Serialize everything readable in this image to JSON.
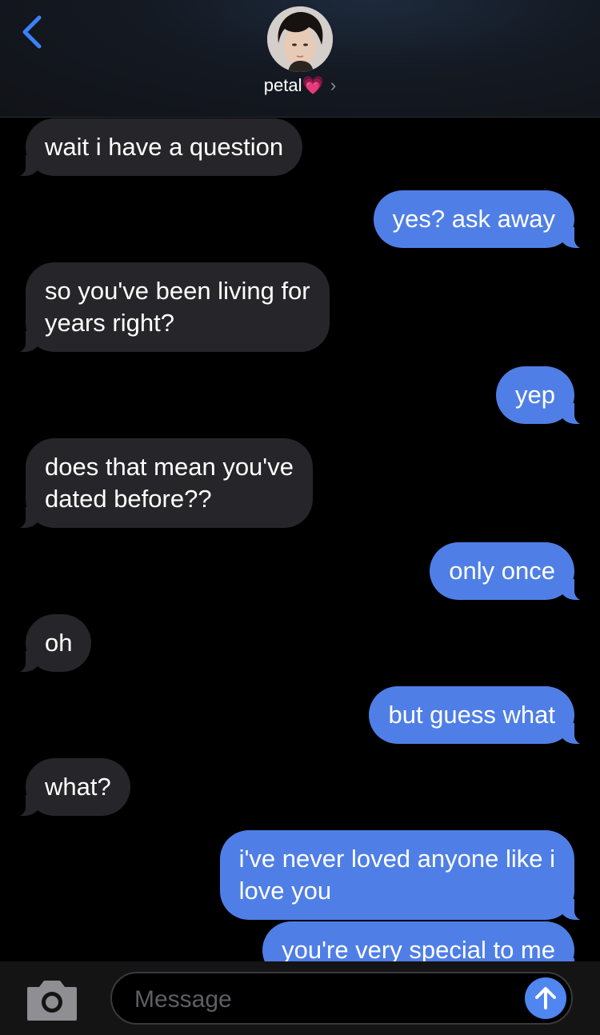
{
  "header": {
    "contact_name": "petal💗",
    "chevron": "›",
    "back_icon": "chevron-left-icon",
    "accent_color": "#3b82f6"
  },
  "messages": [
    {
      "from": "them",
      "text": "wait i have a question"
    },
    {
      "from": "me",
      "text": "yes? ask away"
    },
    {
      "from": "them",
      "line1": "so you've been living for",
      "line2": "years right?"
    },
    {
      "from": "me",
      "text": "yep"
    },
    {
      "from": "them",
      "line1": "does that mean you've",
      "line2": "dated before??"
    },
    {
      "from": "me",
      "text": "only once"
    },
    {
      "from": "them",
      "text": "oh"
    },
    {
      "from": "me",
      "text": "but guess what"
    },
    {
      "from": "them",
      "text": "what?"
    },
    {
      "from": "me",
      "line1": "i've never loved anyone like i",
      "line2": "love you"
    },
    {
      "from": "me",
      "text": "you're very special to me"
    }
  ],
  "composer": {
    "placeholder": "Message",
    "camera_icon": "camera-icon",
    "send_icon": "arrow-up-icon"
  },
  "colors": {
    "incoming_bubble": "#26262a",
    "outgoing_bubble": "#4f7fe6",
    "background": "#000000"
  }
}
